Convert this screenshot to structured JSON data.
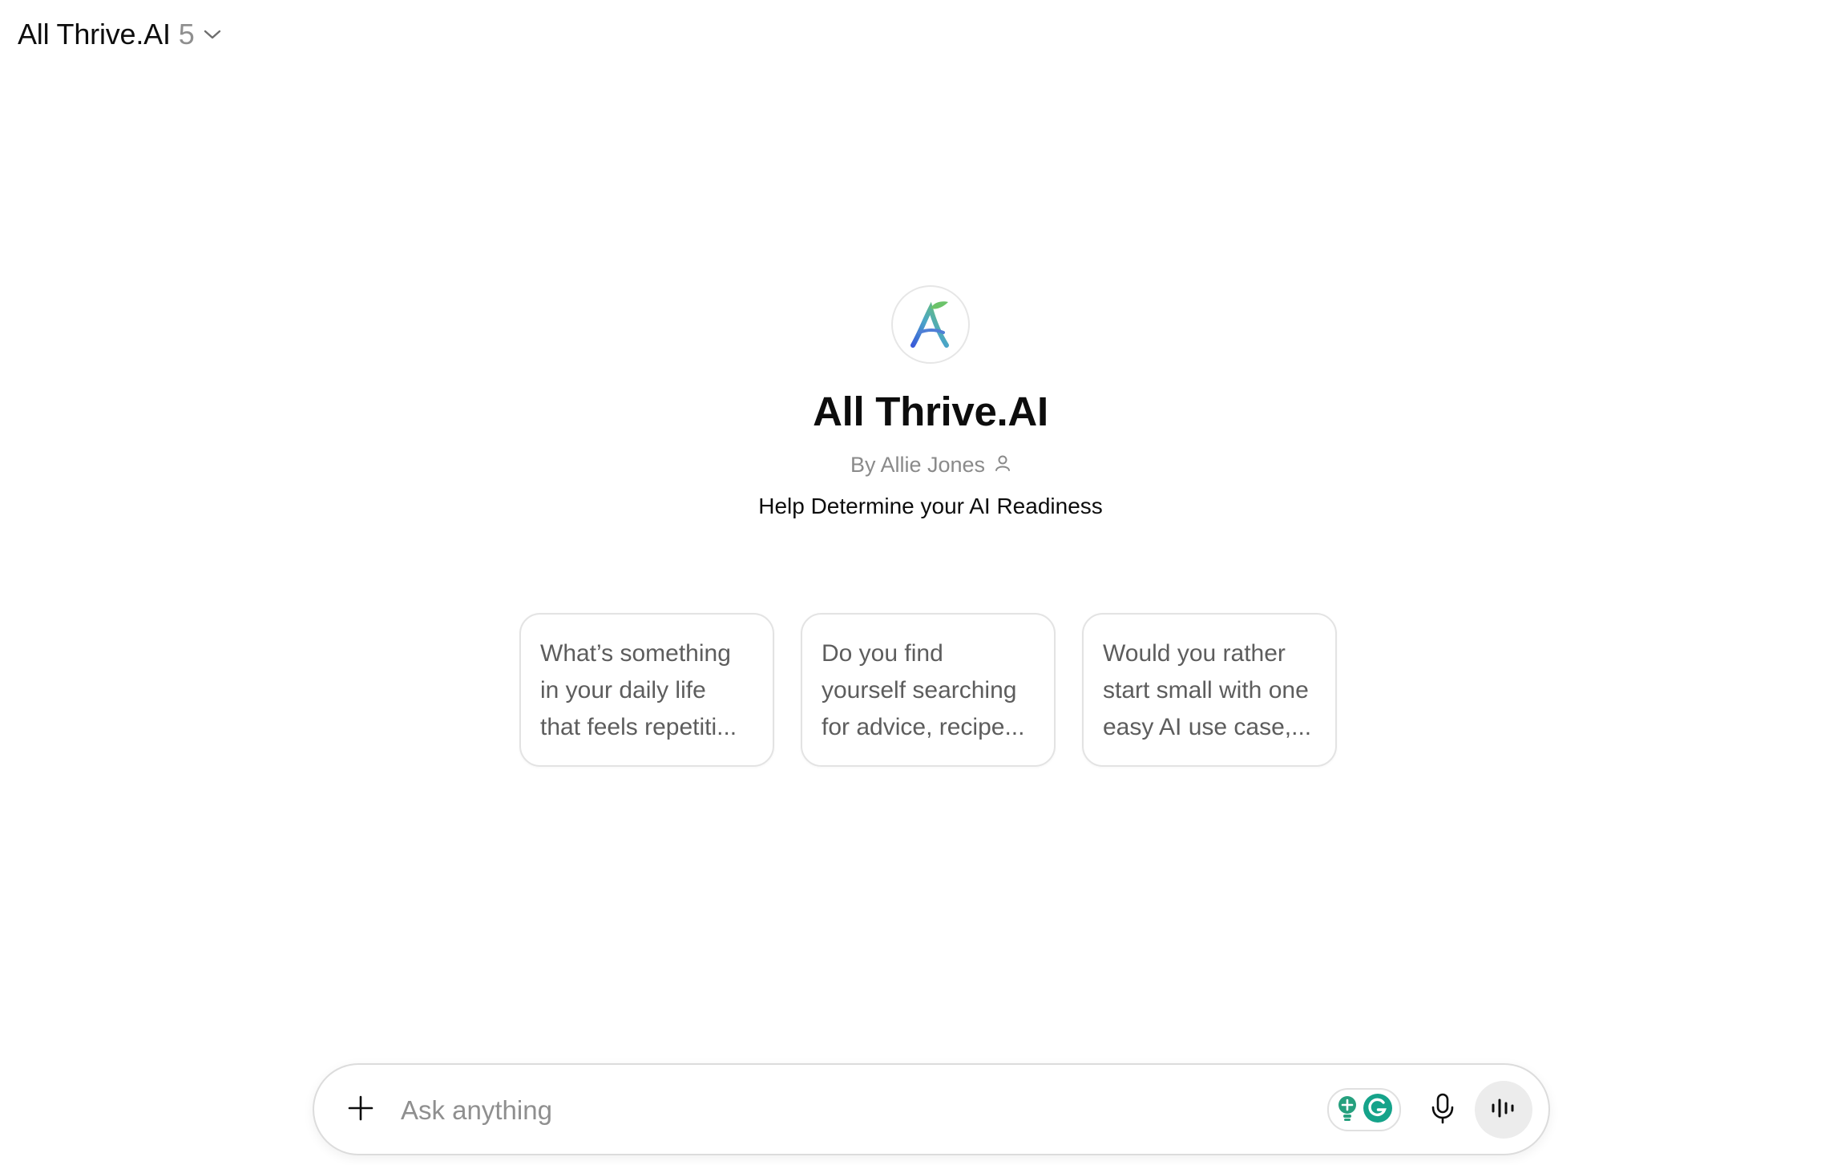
{
  "header": {
    "model_name": "All Thrive.AI",
    "model_version": "5",
    "switcher_icon": "chevron-down-icon"
  },
  "gpt": {
    "logo_icon": "all-thrive-logo-icon",
    "title": "All Thrive.AI",
    "author": "By Allie Jones",
    "author_icon": "person-icon",
    "description": "Help Determine your AI Readiness"
  },
  "suggestions": [
    {
      "lines": [
        "What’s something",
        "in your daily life",
        "that feels repetiti..."
      ]
    },
    {
      "lines": [
        "Do you find",
        "yourself searching",
        "for advice, recipe..."
      ]
    },
    {
      "lines": [
        "Would you rather",
        "start small with one",
        "easy AI use case,..."
      ]
    }
  ],
  "composer": {
    "placeholder": "Ask anything",
    "value": "",
    "attach_icon": "plus-icon",
    "extension_icons": [
      "lightbulb-extension-icon",
      "grammarly-icon"
    ],
    "mic_icon": "microphone-icon",
    "voice_icon": "voice-mode-icon"
  },
  "colors": {
    "text_primary": "#0d0d0d",
    "text_secondary": "#8f8f8f",
    "card_text": "#5d5d5d",
    "border": "#e3e3e3",
    "voice_button_bg": "#ececec",
    "grammarly_green": "#15a38a"
  }
}
